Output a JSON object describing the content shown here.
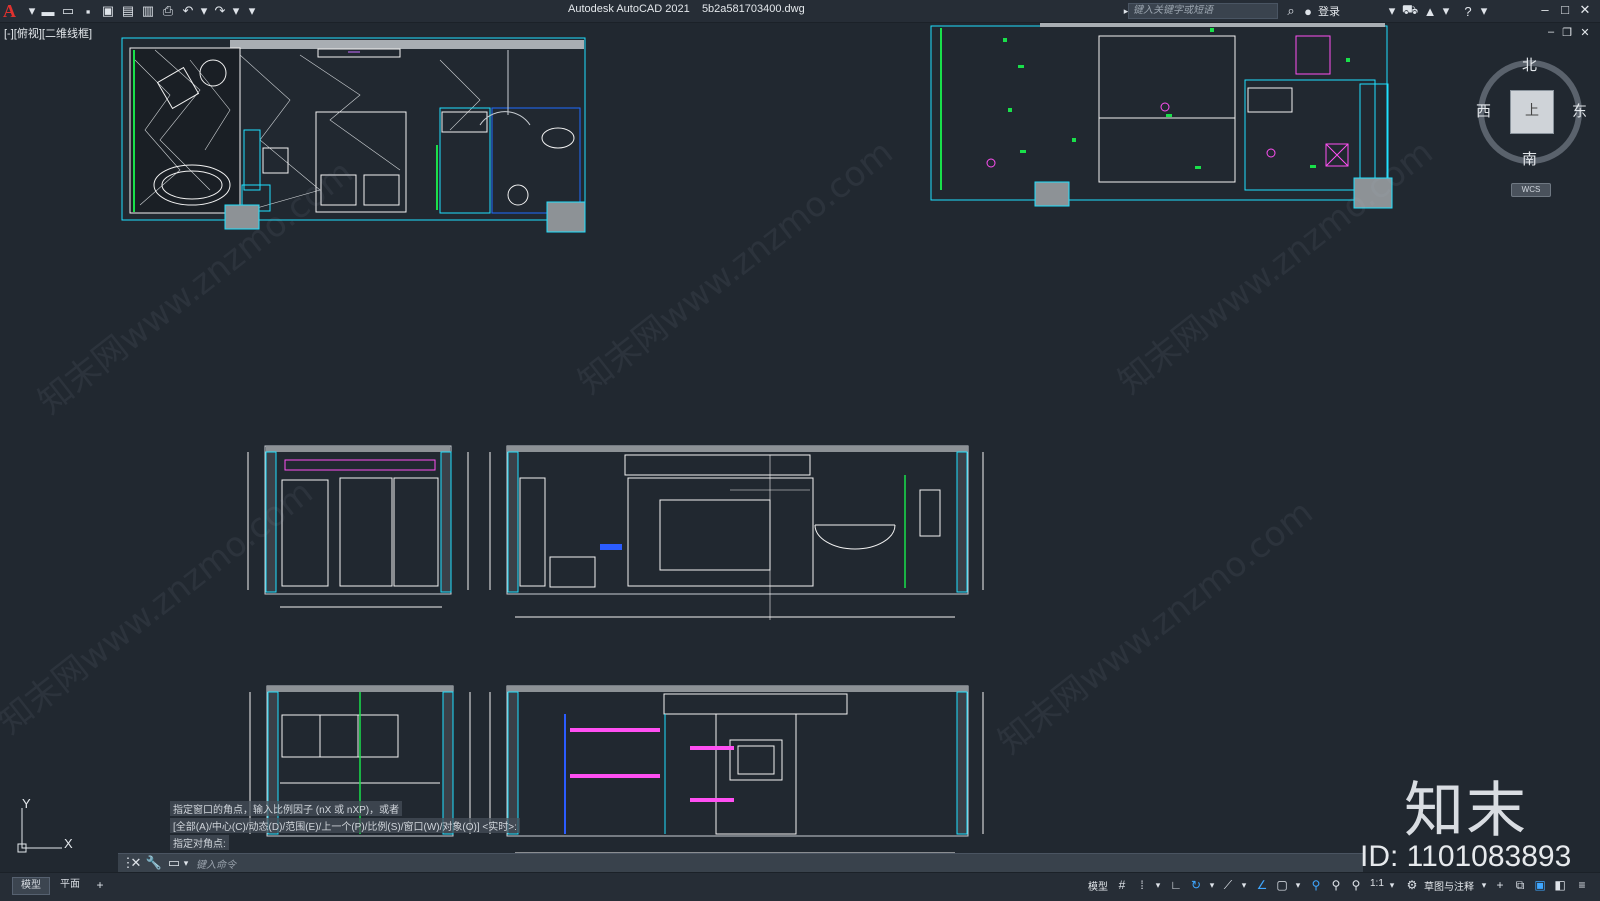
{
  "app": {
    "logo": "A",
    "title": "Autodesk AutoCAD 2021",
    "filename": "5b2a581703400.dwg",
    "search_placeholder": "键入关键字或短语",
    "login": "登录"
  },
  "viewport": {
    "label": "[-][俯视][二维线框]"
  },
  "viewcube": {
    "north": "北",
    "south": "南",
    "east": "东",
    "west": "西",
    "face": "上",
    "wcs": "WCS"
  },
  "ucs": {
    "x": "X",
    "y": "Y"
  },
  "command": {
    "history": [
      "指定窗口的角点，输入比例因子 (nX 或 nXP)，或者",
      "[全部(A)/中心(C)/动态(D)/范围(E)/上一个(P)/比例(S)/窗口(W)/对象(O)] <实时>:",
      "指定对角点:"
    ],
    "input_placeholder": "键入命令"
  },
  "layout_tabs": [
    "模型",
    "平面"
  ],
  "status": {
    "model": "模型",
    "scale": "1:1",
    "workspace": "草图与注释"
  },
  "watermark": {
    "logo": "知末",
    "id": "ID: 1101083893",
    "text": "知末网www.znzmo.com"
  }
}
